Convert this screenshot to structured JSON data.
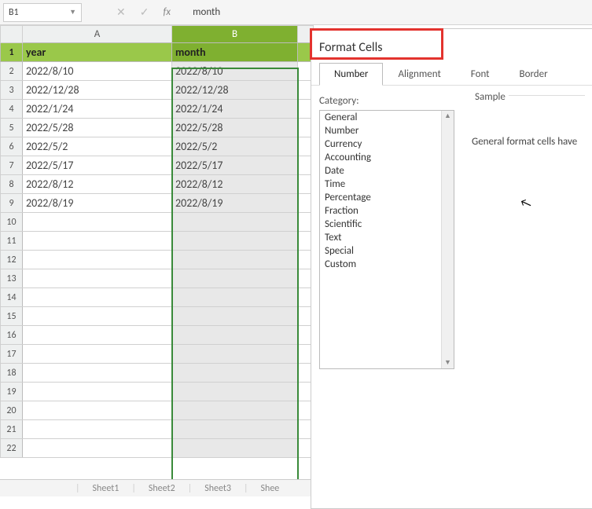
{
  "nameBox": {
    "ref": "B1"
  },
  "formulaBar": {
    "value": "month"
  },
  "columns": [
    "A",
    "B"
  ],
  "headerRow": {
    "A": "year",
    "B": "month"
  },
  "rows": [
    {
      "A": "2022/8/10",
      "B": "2022/8/10"
    },
    {
      "A": "2022/12/28",
      "B": "2022/12/28"
    },
    {
      "A": "2022/1/24",
      "B": "2022/1/24"
    },
    {
      "A": "2022/5/28",
      "B": "2022/5/28"
    },
    {
      "A": "2022/5/2",
      "B": "2022/5/2"
    },
    {
      "A": "2022/5/17",
      "B": "2022/5/17"
    },
    {
      "A": "2022/8/12",
      "B": "2022/8/12"
    },
    {
      "A": "2022/8/19",
      "B": "2022/8/19"
    }
  ],
  "emptyRows": 13,
  "sheetTabs": [
    "Sheet1",
    "Sheet2",
    "Sheet3",
    "Shee"
  ],
  "dialog": {
    "title": "Format Cells",
    "tabs": [
      "Number",
      "Alignment",
      "Font",
      "Border"
    ],
    "activeTab": "Number",
    "categoryLabel": "Category:",
    "categories": [
      "General",
      "Number",
      "Currency",
      "Accounting",
      "Date",
      "Time",
      "Percentage",
      "Fraction",
      "Scientific",
      "Text",
      "Special",
      "Custom"
    ],
    "sampleLabel": "Sample",
    "description": "General format cells have"
  }
}
